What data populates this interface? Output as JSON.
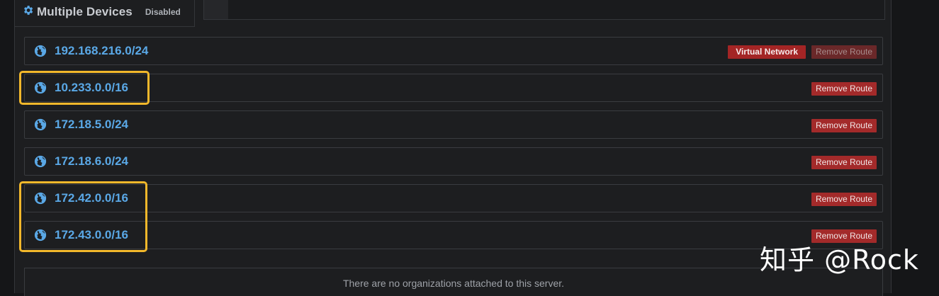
{
  "server_panel": {
    "title": "Multiple Devices",
    "status_badge": "Disabled",
    "icon": "gear-icon"
  },
  "routes": [
    {
      "network": "192.168.216.0/24",
      "virtual_network_label": "Virtual Network",
      "remove_label": "Remove Route",
      "remove_disabled": true,
      "highlighted": false
    },
    {
      "network": "10.233.0.0/16",
      "remove_label": "Remove Route",
      "remove_disabled": false,
      "highlighted": true
    },
    {
      "network": "172.18.5.0/24",
      "remove_label": "Remove Route",
      "remove_disabled": false,
      "highlighted": false
    },
    {
      "network": "172.18.6.0/24",
      "remove_label": "Remove Route",
      "remove_disabled": false,
      "highlighted": false
    },
    {
      "network": "172.42.0.0/16",
      "remove_label": "Remove Route",
      "remove_disabled": false,
      "highlighted": true
    },
    {
      "network": "172.43.0.0/16",
      "remove_label": "Remove Route",
      "remove_disabled": false,
      "highlighted": true
    }
  ],
  "organizations": {
    "empty_message": "There are no organizations attached to this server."
  },
  "watermark": {
    "text": "知乎 @Rock"
  },
  "colors": {
    "background": "#1d1e20",
    "route_text": "#5aa8e6",
    "danger": "#a32a2a",
    "highlight": "#f2b82b"
  }
}
